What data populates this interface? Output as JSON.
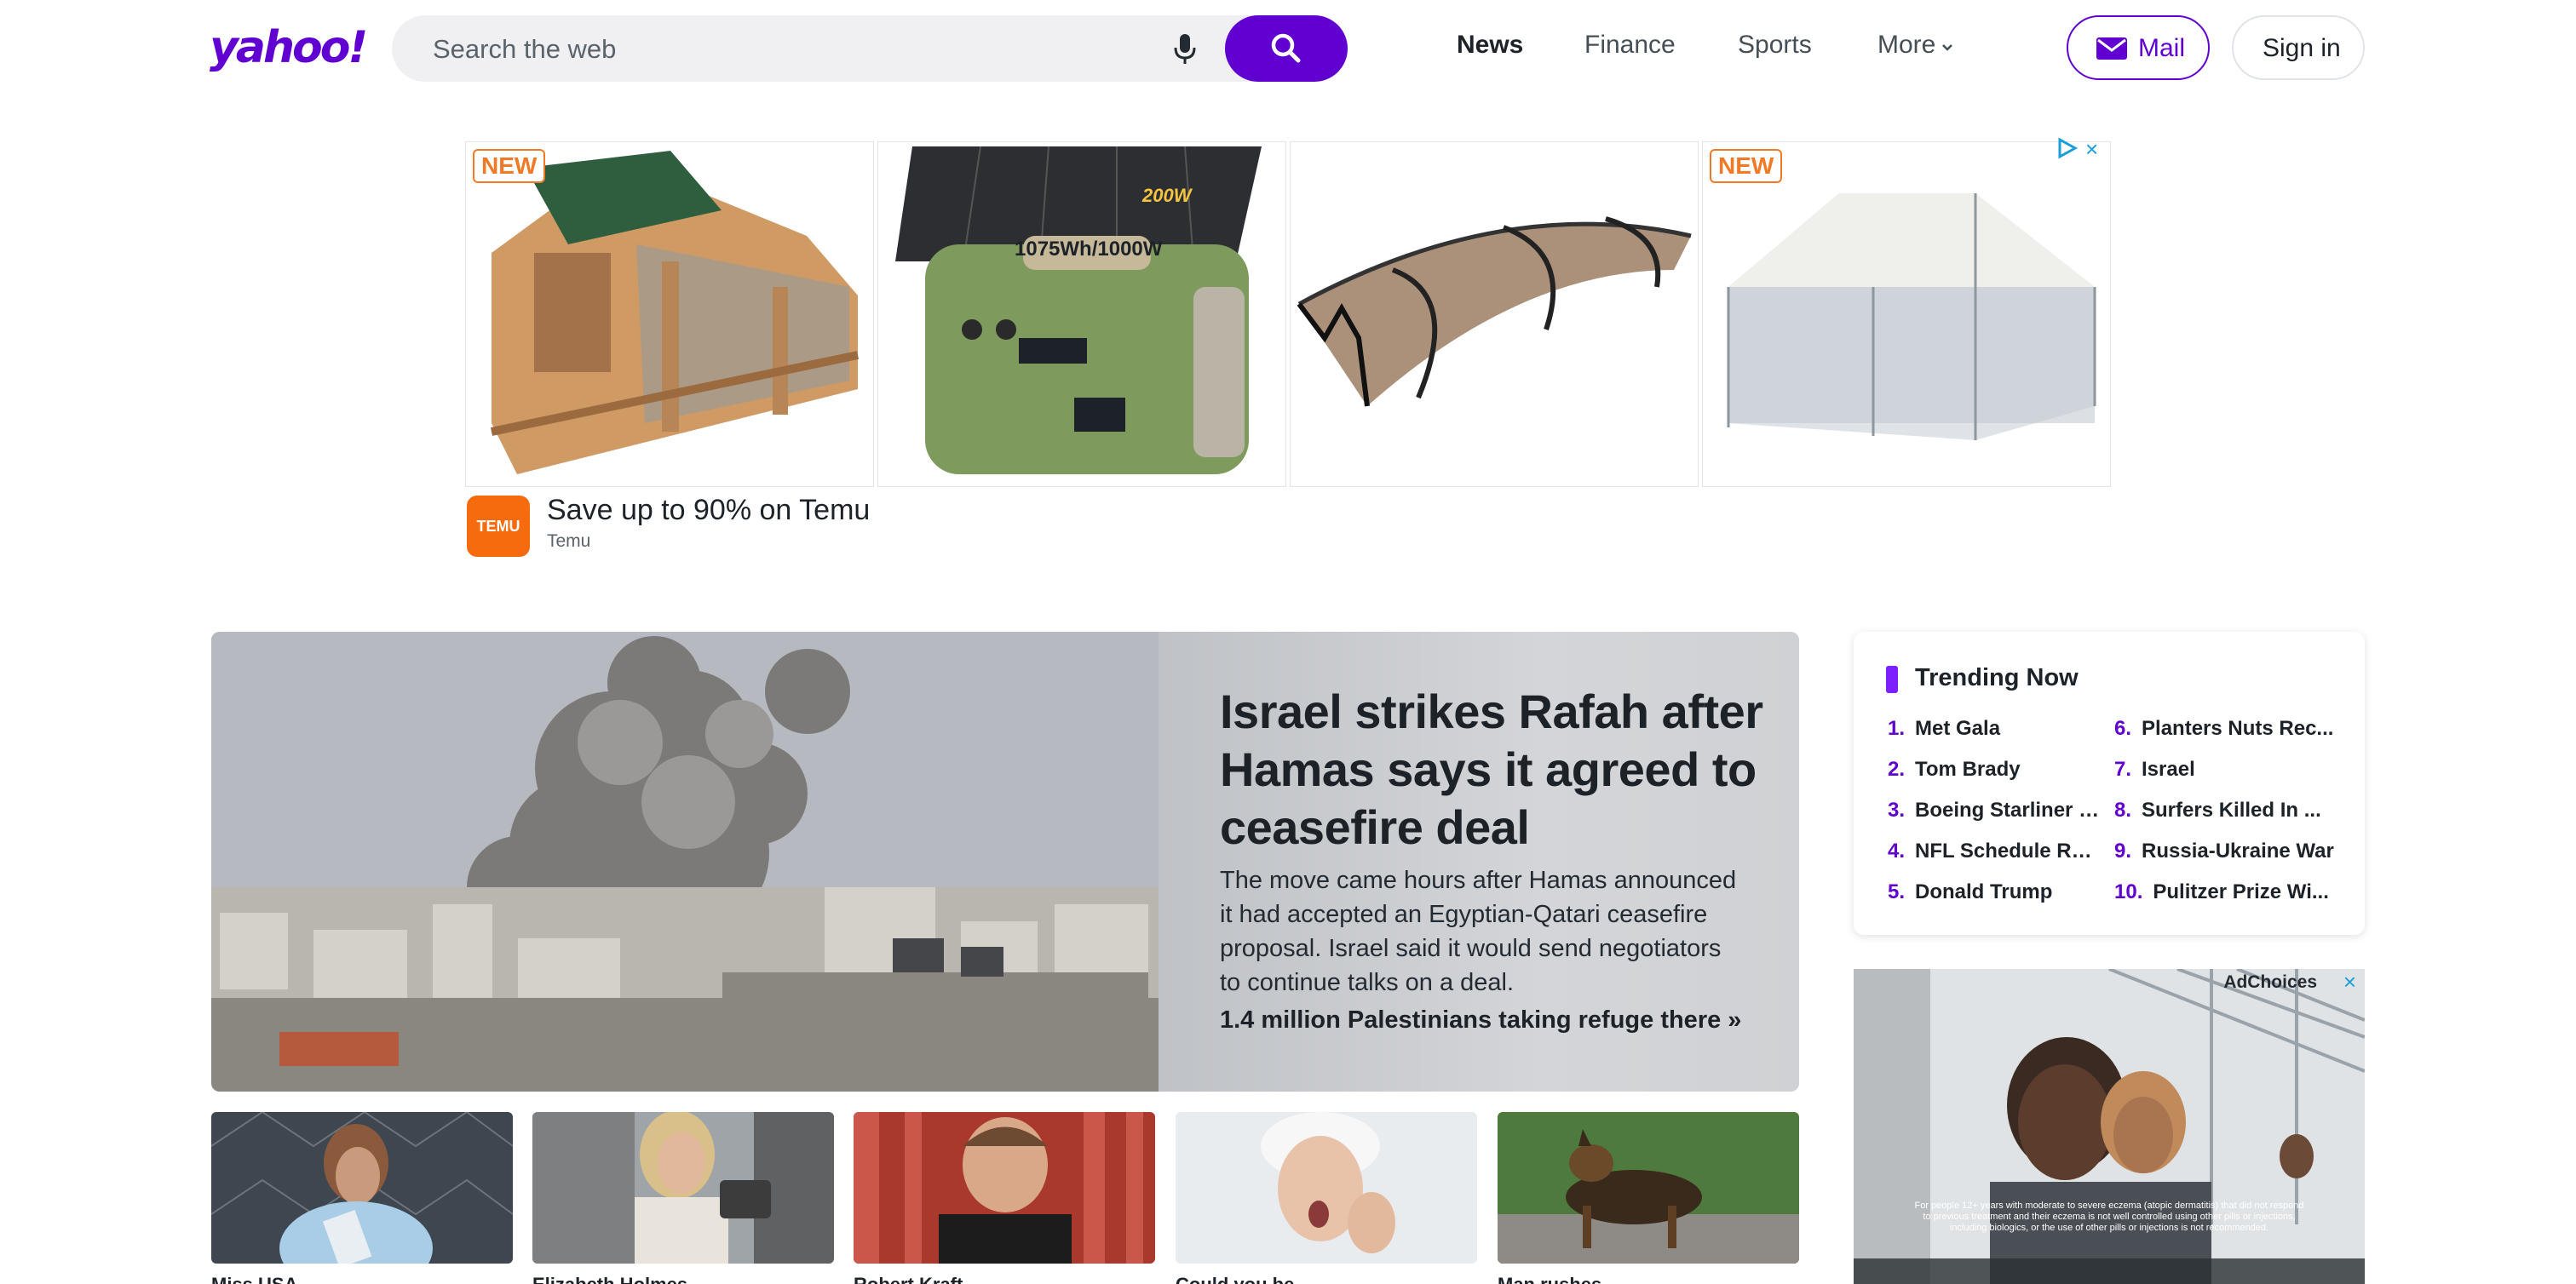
{
  "header": {
    "logo": "yahoo!",
    "search_placeholder": "Search the web",
    "nav": [
      "News",
      "Finance",
      "Sports",
      "More"
    ],
    "mail_label": "Mail",
    "signin_label": "Sign in"
  },
  "ad": {
    "badge_new": "NEW",
    "tile2_text_top": "200W",
    "tile2_text_main": "1075Wh/1000W",
    "title": "Save up to 90% on Temu",
    "source": "Temu",
    "logo_text": "TEMU",
    "close_icon": "×"
  },
  "hero": {
    "title": "Israel strikes Rafah after Hamas says it agreed to ceasefire deal",
    "subtitle": "The move came hours after Hamas announced it had accepted an Egyptian-Qatari ceasefire proposal. Israel said it would send negotiators to continue talks on a deal.",
    "link": "1.4 million Palestinians taking refuge there »"
  },
  "thumbs": [
    {
      "caption": "Miss USA",
      "image": "pageant-contestant"
    },
    {
      "caption": "Elizabeth Holmes",
      "image": "woman-walking"
    },
    {
      "caption": "Robert Kraft",
      "image": "man-smiling"
    },
    {
      "caption": "Could you be",
      "image": "woman-yawning"
    },
    {
      "caption": "Man rushes",
      "image": "german-shepherd"
    }
  ],
  "trending": {
    "title": "Trending Now",
    "items": [
      {
        "n": "1.",
        "label": "Met Gala"
      },
      {
        "n": "2.",
        "label": "Tom Brady"
      },
      {
        "n": "3.",
        "label": "Boeing Starliner L..."
      },
      {
        "n": "4.",
        "label": "NFL Schedule Rel..."
      },
      {
        "n": "5.",
        "label": "Donald Trump"
      },
      {
        "n": "6.",
        "label": "Planters Nuts Rec..."
      },
      {
        "n": "7.",
        "label": "Israel"
      },
      {
        "n": "8.",
        "label": "Surfers Killed In ..."
      },
      {
        "n": "9.",
        "label": "Russia-Ukraine War"
      },
      {
        "n": "10.",
        "label": "Pulitzer Prize Wi..."
      }
    ]
  },
  "video_ad": {
    "adchoices": "AdChoices",
    "close_icon": "×",
    "fine_print": "For people 12+ years with moderate to severe eczema (atopic dermatitis) that did not respond to previous treatment and their eczema is not well controlled using other pills or injections, including biologics, or the use of other pills or injections is not recommended."
  },
  "colors": {
    "brand": "#6001d2",
    "trend_bar": "#7e1fff",
    "ad_badge": "#f27a26",
    "temu": "#f56b0d"
  }
}
